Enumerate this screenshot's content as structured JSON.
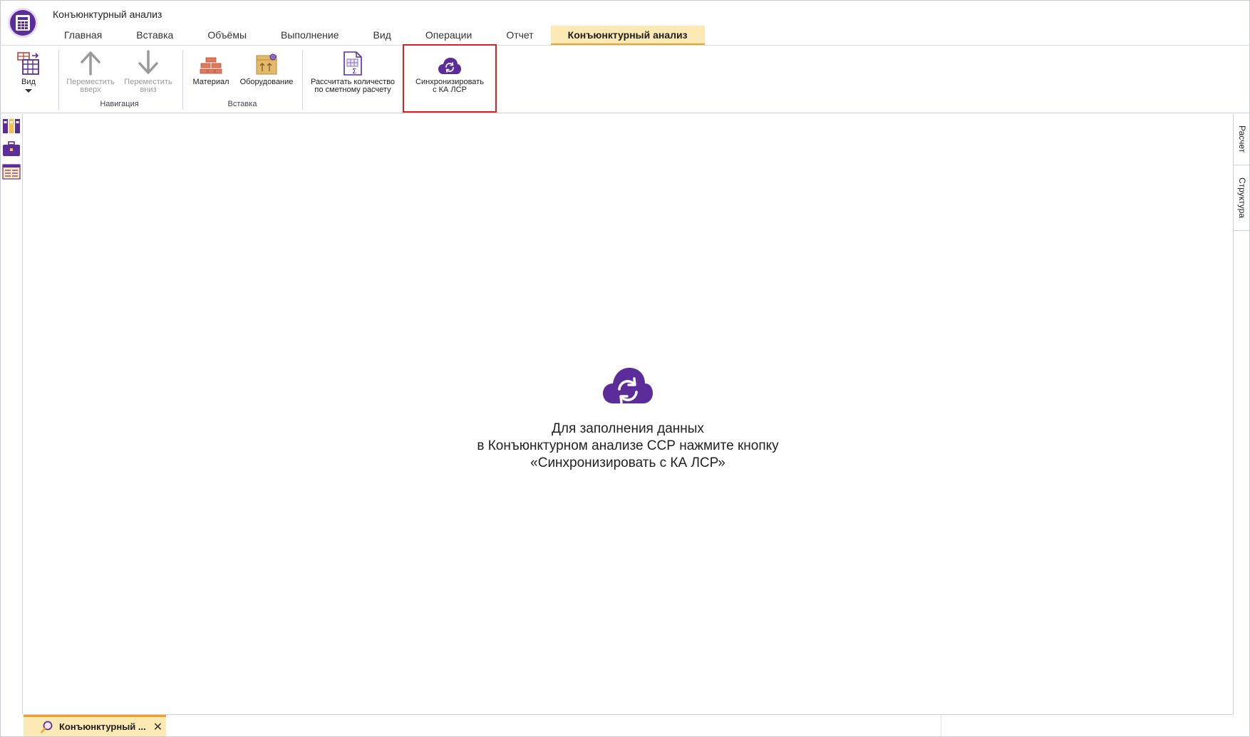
{
  "app": {
    "title": "Конъюнктурный анализ"
  },
  "tabs": [
    "Главная",
    "Вставка",
    "Объёмы",
    "Выполнение",
    "Вид",
    "Операции",
    "Отчет",
    "Конъюнктурный анализ"
  ],
  "active_tab": "Конъюнктурный анализ",
  "ribbon": {
    "view": {
      "label": "Вид"
    },
    "navigation": {
      "move_up": {
        "line1": "Переместить",
        "line2": "вверх"
      },
      "move_down": {
        "line1": "Переместить",
        "line2": "вниз"
      },
      "group_label": "Навигация"
    },
    "insert": {
      "material": {
        "label": "Материал"
      },
      "equipment": {
        "label": "Оборудование"
      },
      "group_label": "Вставка"
    },
    "calc": {
      "line1": "Рассчитать количество",
      "line2": "по сметному расчету"
    },
    "sync": {
      "line1": "Синхронизировать",
      "line2": "с КА ЛСР"
    }
  },
  "right_panel": {
    "tabs": [
      "Расчет",
      "Структура"
    ]
  },
  "empty_state": {
    "line1": "Для заполнения данных",
    "line2": "в Конъюнктурном анализе ССР нажмите кнопку",
    "line3": "«Синхронизировать с КА ЛСР»"
  },
  "doc_tab": {
    "label": "Конъюнктурный ...",
    "close": "✕"
  },
  "colors": {
    "accent": "#5b2c9a",
    "tab_active_bg": "#fde9b3",
    "tab_active_underline": "#f4a021",
    "highlight": "#e02020"
  }
}
